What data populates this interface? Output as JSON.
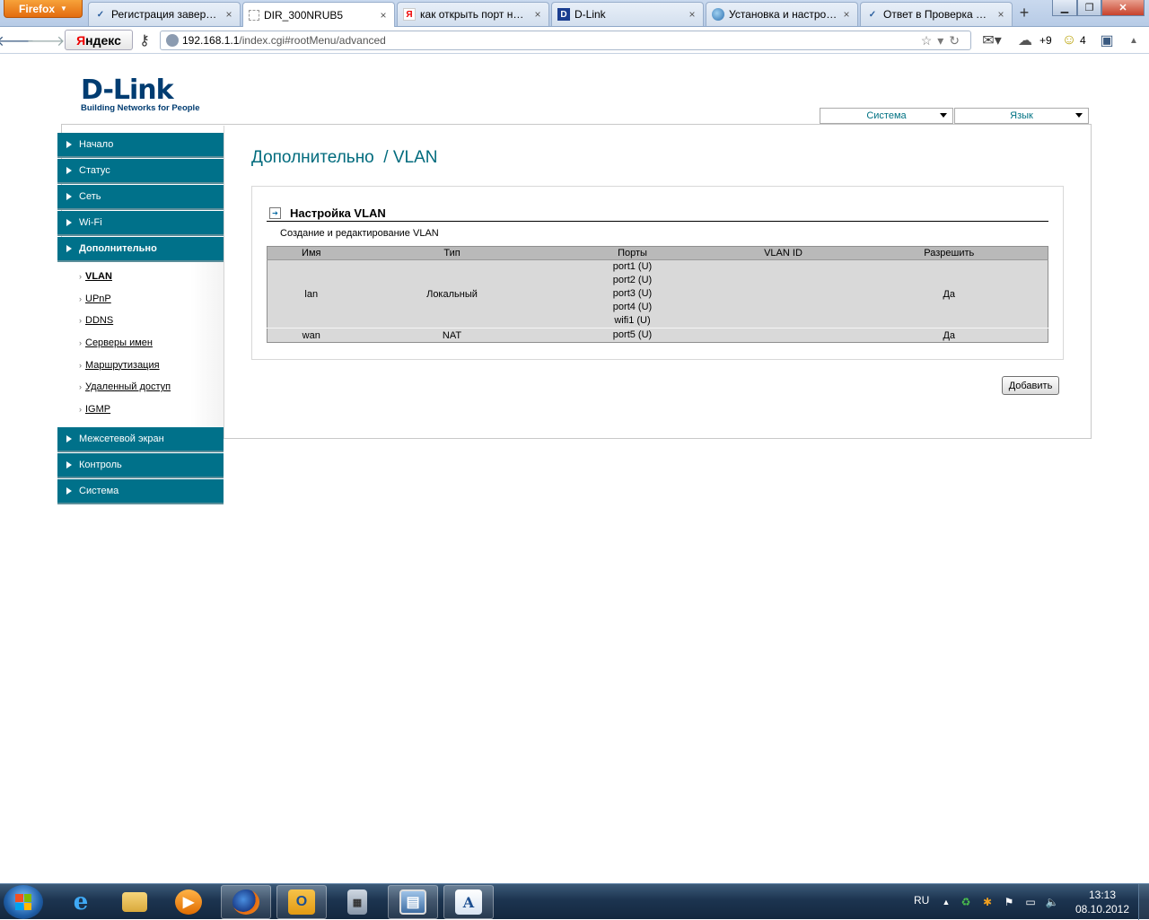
{
  "browser": {
    "firefox_button": "Firefox",
    "tabs": [
      {
        "label": "Регистрация заверше...",
        "icon": "vk-check-icon",
        "active": false
      },
      {
        "label": "DIR_300NRUB5",
        "icon": "blank-page-icon",
        "active": true
      },
      {
        "label": "как открыть порт на ...",
        "icon": "yandex-icon",
        "active": false
      },
      {
        "label": "D-Link",
        "icon": "dlink-icon",
        "active": false
      },
      {
        "label": "Установка и настрой...",
        "icon": "globe-icon",
        "active": false
      },
      {
        "label": "Ответ в Проверка дос...",
        "icon": "vk-check-icon",
        "active": false
      }
    ],
    "new_tab": "+",
    "yandex_logo_y": "Я",
    "yandex_logo_rest": "ндекс",
    "url_host": "192.168.1.1",
    "url_path": "/index.cgi#rootMenu/advanced",
    "weather": "+9",
    "notifications_count": "4"
  },
  "page": {
    "brand": "D-Link",
    "tagline": "Building Networks for People",
    "top_selects": {
      "system": "Система",
      "language": "Язык"
    },
    "title": "Дополнительно  / VLAN",
    "sidebar": {
      "items_top": [
        "Начало",
        "Статус",
        "Сеть",
        "Wi-Fi"
      ],
      "open_item": "Дополнительно",
      "subitems": [
        "VLAN",
        "UPnP",
        "DDNS",
        "Серверы имен",
        "Маршрутизация",
        "Удаленный доступ",
        "IGMP"
      ],
      "active_subitem": "VLAN",
      "items_bottom": [
        "Межсетевой экран",
        "Контроль",
        "Система"
      ]
    },
    "section": {
      "title": "Настройка VLAN",
      "description": "Создание и редактирование VLAN"
    },
    "table": {
      "headers": [
        "Имя",
        "Тип",
        "Порты",
        "VLAN ID",
        "Разрешить"
      ],
      "rows": [
        {
          "name": "lan",
          "type": "Локальный",
          "ports": [
            "port1 (U)",
            "port2 (U)",
            "port3 (U)",
            "port4 (U)",
            "wifi1 (U)"
          ],
          "vlan_id": "",
          "enabled": "Да"
        },
        {
          "name": "wan",
          "type": "NAT",
          "ports": [
            "port5 (U)"
          ],
          "vlan_id": "",
          "enabled": "Да"
        }
      ]
    },
    "add_button": "Добавить"
  },
  "taskbar": {
    "language": "RU",
    "time": "13:13",
    "date": "08.10.2012"
  }
}
